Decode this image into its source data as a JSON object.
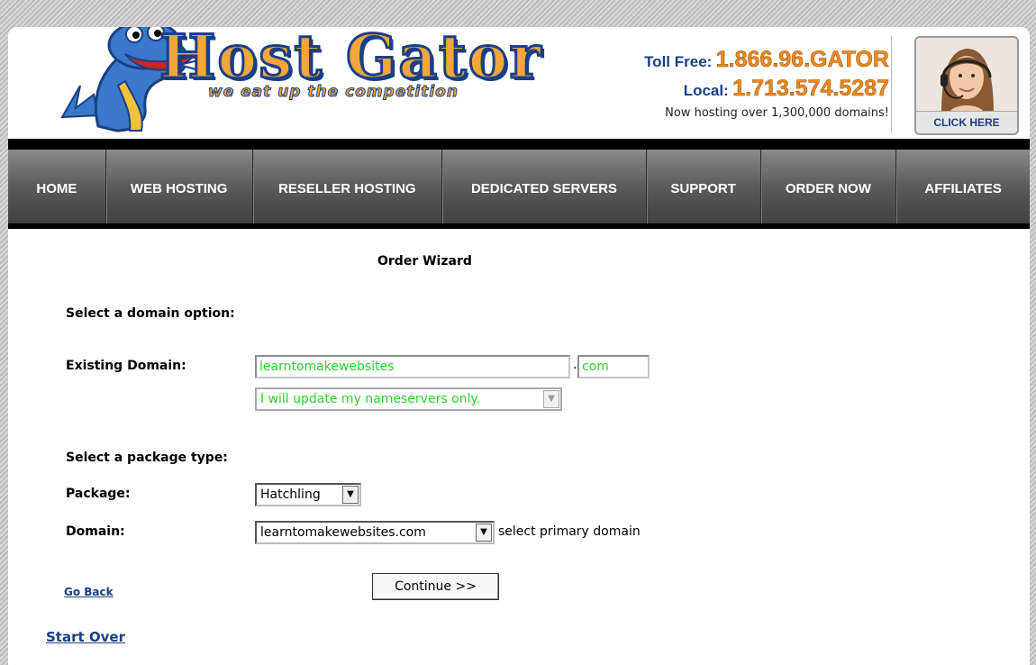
{
  "header": {
    "logo_text": "Host Gator",
    "tagline": "we eat up the competition",
    "toll_free_label": "Toll Free:",
    "toll_free_number": "1.866.96.GATOR",
    "local_label": "Local:",
    "local_number": "1.713.574.5287",
    "hosting_note": "Now hosting over 1,300,000 domains!",
    "click_here_label": "CLICK HERE"
  },
  "nav": {
    "items": [
      "HOME",
      "WEB HOSTING",
      "RESELLER HOSTING",
      "DEDICATED SERVERS",
      "SUPPORT",
      "ORDER NOW",
      "AFFILIATES"
    ]
  },
  "wizard": {
    "title": "Order Wizard",
    "domain_section_label": "Select a domain option:",
    "existing_domain_label": "Existing Domain:",
    "domain_name_value": "learntomakewebsites",
    "dot": ".",
    "tld_value": "com",
    "nameserver_option": "I will update my nameservers only.",
    "package_section_label": "Select a package type:",
    "package_label": "Package:",
    "package_value": "Hatchling",
    "domain_label": "Domain:",
    "primary_domain_value": "learntomakewebsites.com",
    "primary_domain_hint": "select primary domain",
    "go_back_label": "Go Back",
    "continue_label": "Continue >>",
    "start_over_label": "Start Over"
  },
  "colors": {
    "brand_blue": "#1a3f86",
    "brand_orange": "#f08a1d",
    "field_text_green": "#2fd12f"
  }
}
